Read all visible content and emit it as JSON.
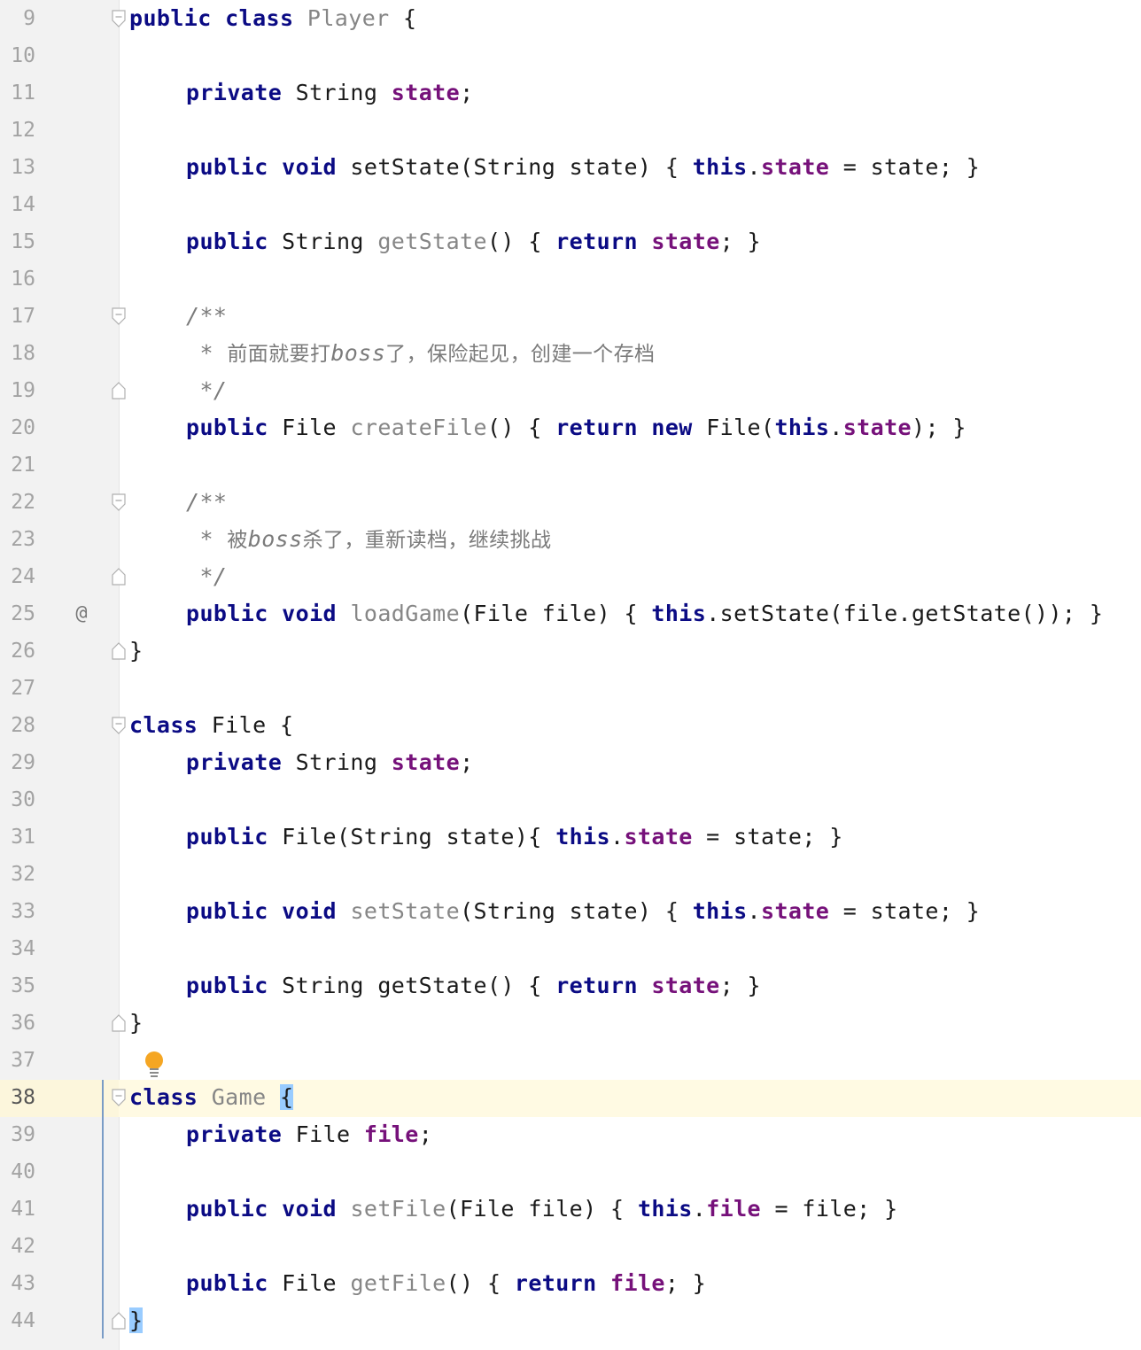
{
  "editor": {
    "current_line": 38,
    "colors": {
      "keyword": "#0b0b84",
      "field": "#76117a",
      "unused_symbol": "#868686",
      "comment": "#7b7b7b",
      "gutter": "#f2f2f2",
      "caret_row": "#fffae3",
      "brace_match": "#99ccff"
    },
    "gutter_annotation_icon": "@",
    "intention_icon": "lightbulb-icon",
    "lines": [
      {
        "n": "9",
        "indent": 0,
        "fold": "open",
        "tokens": [
          [
            "kw",
            "public"
          ],
          [
            "t",
            " "
          ],
          [
            "kw",
            "class"
          ],
          [
            "t",
            " "
          ],
          [
            "unused",
            "Player"
          ],
          [
            "t",
            " {"
          ]
        ]
      },
      {
        "n": "10",
        "indent": 0,
        "tokens": []
      },
      {
        "n": "11",
        "indent": 1,
        "tokens": [
          [
            "kw",
            "private"
          ],
          [
            "t",
            " String "
          ],
          [
            "fld",
            "state"
          ],
          [
            "t",
            ";"
          ]
        ]
      },
      {
        "n": "12",
        "indent": 0,
        "tokens": []
      },
      {
        "n": "13",
        "indent": 1,
        "tokens": [
          [
            "kw",
            "public"
          ],
          [
            "t",
            " "
          ],
          [
            "kw",
            "void"
          ],
          [
            "t",
            " setState(String state) { "
          ],
          [
            "kw",
            "this"
          ],
          [
            "t",
            "."
          ],
          [
            "fld",
            "state"
          ],
          [
            "t",
            " = state; }"
          ]
        ]
      },
      {
        "n": "14",
        "indent": 0,
        "tokens": []
      },
      {
        "n": "15",
        "indent": 1,
        "tokens": [
          [
            "kw",
            "public"
          ],
          [
            "t",
            " String "
          ],
          [
            "unused",
            "getState"
          ],
          [
            "t",
            "() { "
          ],
          [
            "kw",
            "return"
          ],
          [
            "t",
            " "
          ],
          [
            "fld",
            "state"
          ],
          [
            "t",
            "; }"
          ]
        ]
      },
      {
        "n": "16",
        "indent": 0,
        "tokens": []
      },
      {
        "n": "17",
        "indent": 1,
        "fold": "open",
        "tokens": [
          [
            "cmt",
            "/**"
          ]
        ]
      },
      {
        "n": "18",
        "indent": 1,
        "tokens": [
          [
            "cmt",
            " * "
          ],
          [
            "cmtcjk",
            "前面就要打"
          ],
          [
            "cmt",
            "boss"
          ],
          [
            "cmtcjk",
            "了，保险起见，创建一个存档"
          ]
        ]
      },
      {
        "n": "19",
        "indent": 1,
        "fold": "close",
        "tokens": [
          [
            "cmt",
            " */"
          ]
        ]
      },
      {
        "n": "20",
        "indent": 1,
        "tokens": [
          [
            "kw",
            "public"
          ],
          [
            "t",
            " File "
          ],
          [
            "unused",
            "createFile"
          ],
          [
            "t",
            "() { "
          ],
          [
            "kw",
            "return"
          ],
          [
            "t",
            " "
          ],
          [
            "kw",
            "new"
          ],
          [
            "t",
            " File("
          ],
          [
            "kw",
            "this"
          ],
          [
            "t",
            "."
          ],
          [
            "fld",
            "state"
          ],
          [
            "t",
            "); }"
          ]
        ]
      },
      {
        "n": "21",
        "indent": 0,
        "tokens": []
      },
      {
        "n": "22",
        "indent": 1,
        "fold": "open",
        "tokens": [
          [
            "cmt",
            "/**"
          ]
        ]
      },
      {
        "n": "23",
        "indent": 1,
        "tokens": [
          [
            "cmt",
            " * "
          ],
          [
            "cmtcjk",
            "被"
          ],
          [
            "cmt",
            "boss"
          ],
          [
            "cmtcjk",
            "杀了，重新读档，继续挑战"
          ]
        ]
      },
      {
        "n": "24",
        "indent": 1,
        "fold": "close",
        "tokens": [
          [
            "cmt",
            " */"
          ]
        ]
      },
      {
        "n": "25",
        "indent": 1,
        "annotation": true,
        "tokens": [
          [
            "kw",
            "public"
          ],
          [
            "t",
            " "
          ],
          [
            "kw",
            "void"
          ],
          [
            "t",
            " "
          ],
          [
            "unused",
            "loadGame"
          ],
          [
            "t",
            "(File file) { "
          ],
          [
            "kw",
            "this"
          ],
          [
            "t",
            ".setState(file.getState()); }"
          ]
        ]
      },
      {
        "n": "26",
        "indent": 0,
        "fold": "close",
        "tokens": [
          [
            "t",
            "}"
          ]
        ]
      },
      {
        "n": "27",
        "indent": 0,
        "tokens": []
      },
      {
        "n": "28",
        "indent": 0,
        "fold": "open",
        "tokens": [
          [
            "kw",
            "class"
          ],
          [
            "t",
            " File {"
          ]
        ]
      },
      {
        "n": "29",
        "indent": 1,
        "tokens": [
          [
            "kw",
            "private"
          ],
          [
            "t",
            " String "
          ],
          [
            "fld",
            "state"
          ],
          [
            "t",
            ";"
          ]
        ]
      },
      {
        "n": "30",
        "indent": 0,
        "tokens": []
      },
      {
        "n": "31",
        "indent": 1,
        "tokens": [
          [
            "kw",
            "public"
          ],
          [
            "t",
            " File(String state){ "
          ],
          [
            "kw",
            "this"
          ],
          [
            "t",
            "."
          ],
          [
            "fld",
            "state"
          ],
          [
            "t",
            " = state; }"
          ]
        ]
      },
      {
        "n": "32",
        "indent": 0,
        "tokens": []
      },
      {
        "n": "33",
        "indent": 1,
        "tokens": [
          [
            "kw",
            "public"
          ],
          [
            "t",
            " "
          ],
          [
            "kw",
            "void"
          ],
          [
            "t",
            " "
          ],
          [
            "unused",
            "setState"
          ],
          [
            "t",
            "(String state) { "
          ],
          [
            "kw",
            "this"
          ],
          [
            "t",
            "."
          ],
          [
            "fld",
            "state"
          ],
          [
            "t",
            " = state; }"
          ]
        ]
      },
      {
        "n": "34",
        "indent": 0,
        "tokens": []
      },
      {
        "n": "35",
        "indent": 1,
        "tokens": [
          [
            "kw",
            "public"
          ],
          [
            "t",
            " String getState() { "
          ],
          [
            "kw",
            "return"
          ],
          [
            "t",
            " "
          ],
          [
            "fld",
            "state"
          ],
          [
            "t",
            "; }"
          ]
        ]
      },
      {
        "n": "36",
        "indent": 0,
        "fold": "close",
        "tokens": [
          [
            "t",
            "}"
          ]
        ]
      },
      {
        "n": "37",
        "indent": 0,
        "tokens": []
      },
      {
        "n": "38",
        "indent": 0,
        "fold": "open",
        "tokens": [
          [
            "kw",
            "class"
          ],
          [
            "t",
            " "
          ],
          [
            "unused",
            "Game"
          ],
          [
            "t",
            " "
          ],
          [
            "brace",
            "{"
          ]
        ]
      },
      {
        "n": "39",
        "indent": 1,
        "tokens": [
          [
            "kw",
            "private"
          ],
          [
            "t",
            " File "
          ],
          [
            "fld",
            "file"
          ],
          [
            "t",
            ";"
          ]
        ]
      },
      {
        "n": "40",
        "indent": 0,
        "tokens": []
      },
      {
        "n": "41",
        "indent": 1,
        "tokens": [
          [
            "kw",
            "public"
          ],
          [
            "t",
            " "
          ],
          [
            "kw",
            "void"
          ],
          [
            "t",
            " "
          ],
          [
            "unused",
            "setFile"
          ],
          [
            "t",
            "(File file) { "
          ],
          [
            "kw",
            "this"
          ],
          [
            "t",
            "."
          ],
          [
            "fld",
            "file"
          ],
          [
            "t",
            " = file; }"
          ]
        ]
      },
      {
        "n": "42",
        "indent": 0,
        "tokens": []
      },
      {
        "n": "43",
        "indent": 1,
        "tokens": [
          [
            "kw",
            "public"
          ],
          [
            "t",
            " File "
          ],
          [
            "unused",
            "getFile"
          ],
          [
            "t",
            "() { "
          ],
          [
            "kw",
            "return"
          ],
          [
            "t",
            " "
          ],
          [
            "fld",
            "file"
          ],
          [
            "t",
            "; }"
          ]
        ]
      },
      {
        "n": "44",
        "indent": 0,
        "fold": "close",
        "tokens": [
          [
            "brace",
            "}"
          ]
        ]
      }
    ]
  }
}
